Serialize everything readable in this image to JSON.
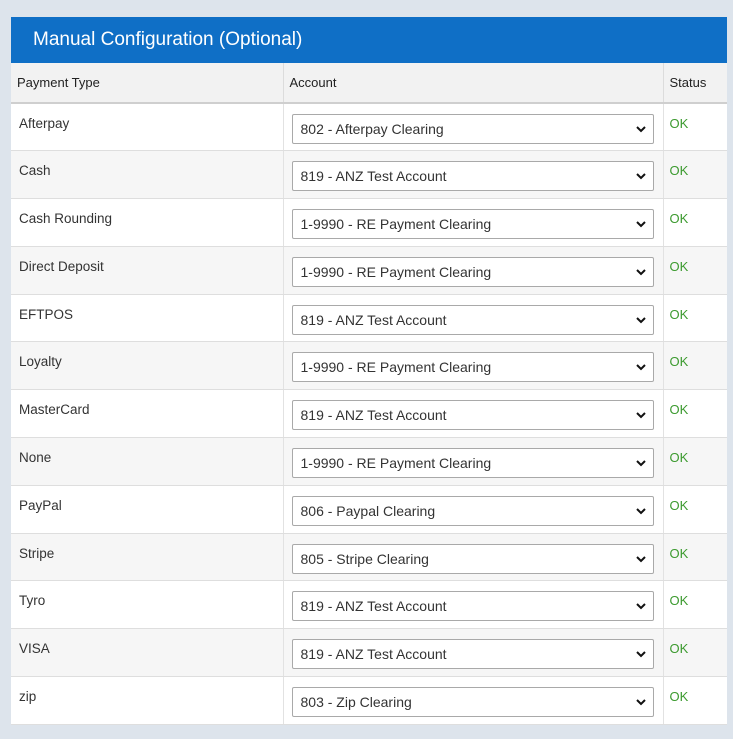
{
  "panel": {
    "title": "Manual Configuration (Optional)"
  },
  "table": {
    "headers": {
      "payment_type": "Payment Type",
      "account": "Account",
      "status": "Status"
    },
    "rows": [
      {
        "payment_type": "Afterpay",
        "account": "802 - Afterpay Clearing",
        "status": "OK"
      },
      {
        "payment_type": "Cash",
        "account": "819 - ANZ Test Account",
        "status": "OK"
      },
      {
        "payment_type": "Cash Rounding",
        "account": "1-9990 - RE Payment Clearing",
        "status": "OK"
      },
      {
        "payment_type": "Direct Deposit",
        "account": "1-9990 - RE Payment Clearing",
        "status": "OK"
      },
      {
        "payment_type": "EFTPOS",
        "account": "819 - ANZ Test Account",
        "status": "OK"
      },
      {
        "payment_type": "Loyalty",
        "account": "1-9990 - RE Payment Clearing",
        "status": "OK"
      },
      {
        "payment_type": "MasterCard",
        "account": "819 - ANZ Test Account",
        "status": "OK"
      },
      {
        "payment_type": "None",
        "account": "1-9990 - RE Payment Clearing",
        "status": "OK"
      },
      {
        "payment_type": "PayPal",
        "account": "806 - Paypal Clearing",
        "status": "OK"
      },
      {
        "payment_type": "Stripe",
        "account": "805 - Stripe Clearing",
        "status": "OK"
      },
      {
        "payment_type": "Tyro",
        "account": "819 - ANZ Test Account",
        "status": "OK"
      },
      {
        "payment_type": "VISA",
        "account": "819 - ANZ Test Account",
        "status": "OK"
      },
      {
        "payment_type": "zip",
        "account": "803 - Zip Clearing",
        "status": "OK"
      }
    ]
  },
  "icons": {
    "dropdown": "chevron-down-icon"
  },
  "colors": {
    "header_bg": "#0f6fc6",
    "status_ok": "#3c9a2f",
    "page_bg": "#dde4ec"
  }
}
